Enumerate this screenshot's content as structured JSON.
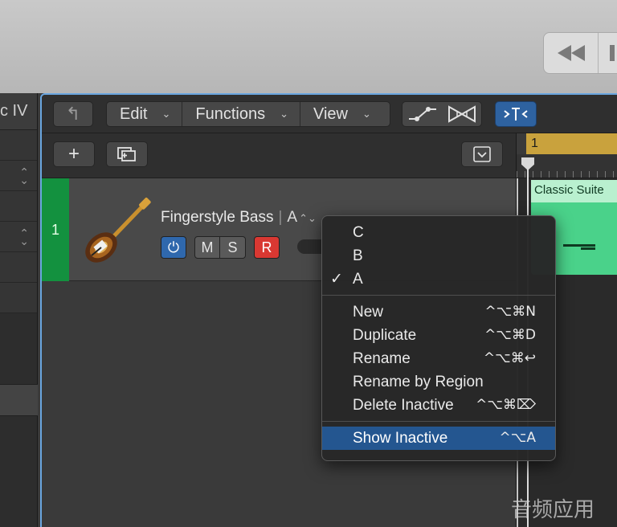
{
  "left_panel": {
    "header_fragment": "c IV"
  },
  "toolbar": {
    "menus": [
      {
        "label": "Edit",
        "chevron": "⌄"
      },
      {
        "label": "Functions",
        "chevron": "⌄"
      },
      {
        "label": "View",
        "chevron": "⌄"
      }
    ],
    "back_icon": "↰",
    "add_icon": "+",
    "collapse_icon": "⌄"
  },
  "track": {
    "number": "1",
    "name": "Fingerstyle Bass",
    "alternative": "A",
    "mute_label": "M",
    "solo_label": "S",
    "record_label": "R",
    "power_icon": "⏻"
  },
  "timeline": {
    "bar_number": "1",
    "region_name": "Classic Suite"
  },
  "context_menu": {
    "alternatives": [
      {
        "label": "C",
        "checked": false
      },
      {
        "label": "B",
        "checked": false
      },
      {
        "label": "A",
        "checked": true
      }
    ],
    "check_mark": "✓",
    "actions": [
      {
        "label": "New",
        "shortcut": "^⌥⌘N"
      },
      {
        "label": "Duplicate",
        "shortcut": "^⌥⌘D"
      },
      {
        "label": "Rename",
        "shortcut": "^⌥⌘↩"
      },
      {
        "label": "Rename by Region",
        "shortcut": ""
      },
      {
        "label": "Delete Inactive",
        "shortcut": "^⌥⌘⌦"
      }
    ],
    "highlighted": {
      "label": "Show Inactive",
      "shortcut": "^⌥A"
    }
  },
  "watermark": "音频应用",
  "colors": {
    "track_green": "#13913f",
    "region_green": "#4ad28a",
    "accent_blue": "#2e62a0",
    "record_red": "#d93832",
    "highlight_blue": "#245690"
  }
}
